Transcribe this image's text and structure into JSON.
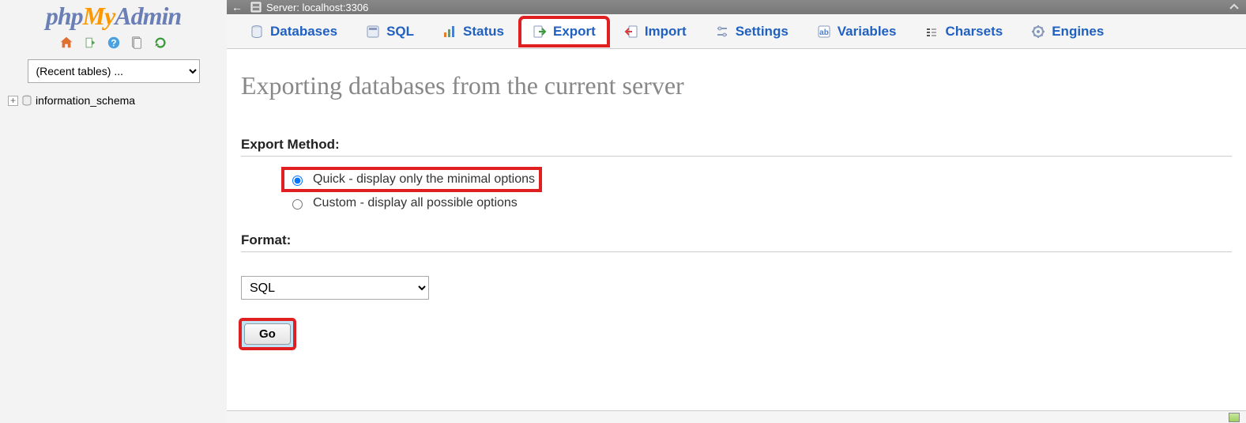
{
  "logo": {
    "text_parts": [
      "php",
      "My",
      "Admin"
    ]
  },
  "sidebar": {
    "recent_placeholder": "(Recent tables) ...",
    "db_name": "information_schema"
  },
  "serverbar": {
    "back_glyph": "←",
    "label": "Server: localhost:3306"
  },
  "tabs": [
    {
      "key": "databases",
      "label": "Databases",
      "icon": "db"
    },
    {
      "key": "sql",
      "label": "SQL",
      "icon": "sql"
    },
    {
      "key": "status",
      "label": "Status",
      "icon": "status"
    },
    {
      "key": "export",
      "label": "Export",
      "icon": "export",
      "active": true,
      "highlight": true
    },
    {
      "key": "import",
      "label": "Import",
      "icon": "import"
    },
    {
      "key": "settings",
      "label": "Settings",
      "icon": "settings"
    },
    {
      "key": "variables",
      "label": "Variables",
      "icon": "variables"
    },
    {
      "key": "charsets",
      "label": "Charsets",
      "icon": "charsets"
    },
    {
      "key": "engines",
      "label": "Engines",
      "icon": "engines"
    }
  ],
  "page": {
    "title": "Exporting databases from the current server",
    "method_label": "Export Method:",
    "method_quick": "Quick - display only the minimal options",
    "method_custom": "Custom - display all possible options",
    "format_label": "Format:",
    "format_selected": "SQL",
    "go_label": "Go"
  }
}
